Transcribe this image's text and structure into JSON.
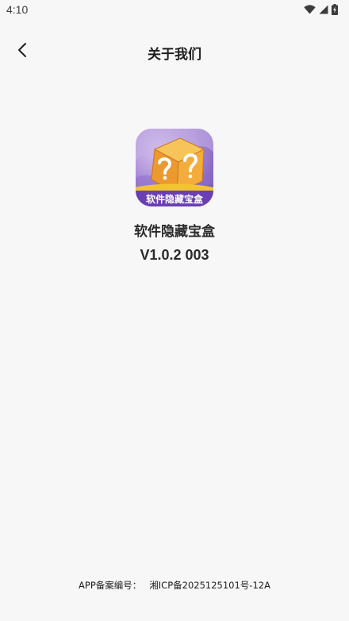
{
  "status_bar": {
    "time": "4:10",
    "icons": [
      "wifi-icon",
      "cellular-signal-icon",
      "battery-charging-icon"
    ]
  },
  "header": {
    "title": "关于我们",
    "back_icon": "chevron-left-icon"
  },
  "app": {
    "icon_label": "软件隐藏宝盒",
    "name": "软件隐藏宝盒",
    "version": "V1.0.2 003"
  },
  "footer": {
    "icp_label": "APP备案编号：",
    "icp_number": "湘ICP备2025125101号-12A"
  },
  "colors": {
    "background": "#f7f7f7",
    "icon_purple": "#6a3fb5",
    "icon_box": "#f0a83a",
    "icon_stripe": "#f3c431"
  }
}
